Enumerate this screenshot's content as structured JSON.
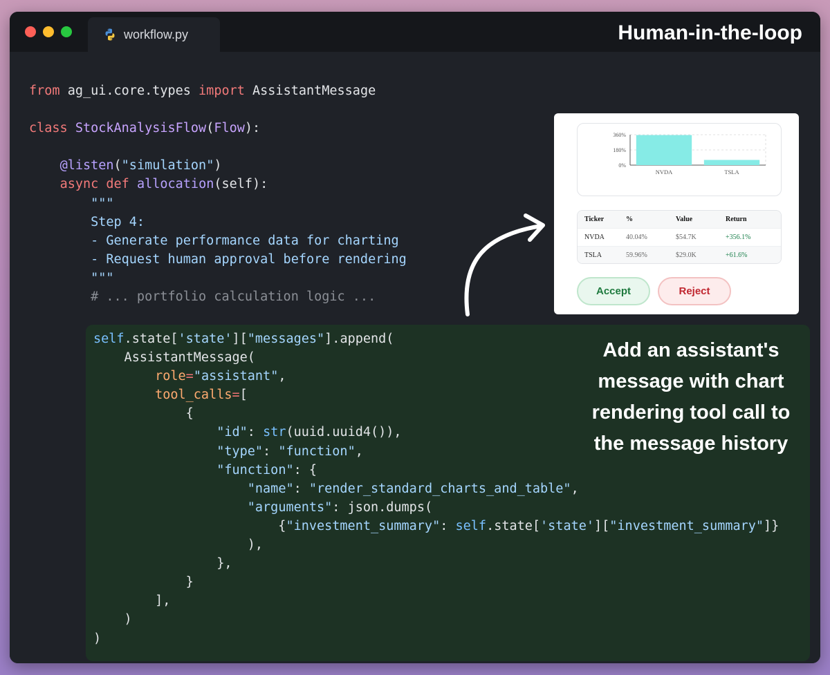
{
  "window": {
    "tab_label": "workflow.py",
    "heading": "Human-in-the-loop"
  },
  "code_top": [
    [
      [
        "kw",
        "from"
      ],
      [
        "p",
        " ag_ui.core.types "
      ],
      [
        "kw",
        "import"
      ],
      [
        "p",
        " AssistantMessage"
      ]
    ],
    [],
    [
      [
        "kw",
        "class"
      ],
      [
        "p",
        " "
      ],
      [
        "cls",
        "StockAnalysisFlow"
      ],
      [
        "p",
        "("
      ],
      [
        "cls",
        "Flow"
      ],
      [
        "p",
        "):"
      ]
    ],
    [],
    [
      [
        "p",
        "    "
      ],
      [
        "fn",
        "@listen"
      ],
      [
        "p",
        "("
      ],
      [
        "str",
        "\"simulation\""
      ],
      [
        "p",
        ")"
      ]
    ],
    [
      [
        "p",
        "    "
      ],
      [
        "kw",
        "async"
      ],
      [
        "p",
        " "
      ],
      [
        "kw",
        "def"
      ],
      [
        "p",
        " "
      ],
      [
        "fn",
        "allocation"
      ],
      [
        "p",
        "(self):"
      ]
    ],
    [
      [
        "p",
        "        "
      ],
      [
        "doc",
        "\"\"\""
      ]
    ],
    [
      [
        "p",
        "        "
      ],
      [
        "doc",
        "Step 4:"
      ]
    ],
    [
      [
        "p",
        "        "
      ],
      [
        "doc",
        "- Generate performance data for charting"
      ]
    ],
    [
      [
        "p",
        "        "
      ],
      [
        "doc",
        "- Request human approval before rendering"
      ]
    ],
    [
      [
        "p",
        "        "
      ],
      [
        "doc",
        "\"\"\""
      ]
    ],
    [
      [
        "p",
        "        "
      ],
      [
        "cm",
        "# ... portfolio calculation logic ..."
      ]
    ]
  ],
  "code_block": [
    [
      [
        "bi",
        "self"
      ],
      [
        "p",
        ".state["
      ],
      [
        "str",
        "'state'"
      ],
      [
        "p",
        "]["
      ],
      [
        "str",
        "\"messages\""
      ],
      [
        "p",
        "].append("
      ]
    ],
    [
      [
        "p",
        "    AssistantMessage("
      ]
    ],
    [
      [
        "p",
        "        "
      ],
      [
        "prop",
        "role"
      ],
      [
        "kw2",
        "="
      ],
      [
        "str",
        "\"assistant\""
      ],
      [
        "p",
        ","
      ]
    ],
    [
      [
        "p",
        "        "
      ],
      [
        "prop",
        "tool_calls"
      ],
      [
        "kw2",
        "="
      ],
      [
        "p",
        "["
      ]
    ],
    [
      [
        "p",
        "            {"
      ]
    ],
    [
      [
        "p",
        "                "
      ],
      [
        "str",
        "\"id\""
      ],
      [
        "p",
        ": "
      ],
      [
        "bi",
        "str"
      ],
      [
        "p",
        "(uuid.uuid4()),"
      ]
    ],
    [
      [
        "p",
        "                "
      ],
      [
        "str",
        "\"type\""
      ],
      [
        "p",
        ": "
      ],
      [
        "str",
        "\"function\""
      ],
      [
        "p",
        ","
      ]
    ],
    [
      [
        "p",
        "                "
      ],
      [
        "str",
        "\"function\""
      ],
      [
        "p",
        ": {"
      ]
    ],
    [
      [
        "p",
        "                    "
      ],
      [
        "str",
        "\"name\""
      ],
      [
        "p",
        ": "
      ],
      [
        "str",
        "\"render_standard_charts_and_table\""
      ],
      [
        "p",
        ","
      ]
    ],
    [
      [
        "p",
        "                    "
      ],
      [
        "str",
        "\"arguments\""
      ],
      [
        "p",
        ": json.dumps("
      ]
    ],
    [
      [
        "p",
        "                        {"
      ],
      [
        "str",
        "\"investment_summary\""
      ],
      [
        "p",
        ": "
      ],
      [
        "bi",
        "self"
      ],
      [
        "p",
        ".state["
      ],
      [
        "str",
        "'state'"
      ],
      [
        "p",
        "]["
      ],
      [
        "str",
        "\"investment_summary\""
      ],
      [
        "p",
        "]}"
      ]
    ],
    [
      [
        "p",
        "                    ),"
      ]
    ],
    [
      [
        "p",
        "                },"
      ]
    ],
    [
      [
        "p",
        "            }"
      ]
    ],
    [
      [
        "p",
        "        ],"
      ]
    ],
    [
      [
        "p",
        "    )"
      ]
    ],
    [
      [
        "p",
        ")"
      ]
    ]
  ],
  "annotation": "Add an assistant's message with chart rendering tool call to the message history",
  "preview": {
    "chart_data": {
      "type": "bar",
      "categories": [
        "NVDA",
        "TSLA"
      ],
      "values": [
        356.1,
        61.6
      ],
      "yticks": [
        "360%",
        "180%",
        "0%"
      ],
      "ylim": [
        0,
        360
      ],
      "color": "#86ebe6"
    },
    "table": {
      "headers": [
        "Ticker",
        "%",
        "Value",
        "Return"
      ],
      "rows": [
        [
          "NVDA",
          "40.04%",
          "$54.7K",
          "+356.1%"
        ],
        [
          "TSLA",
          "59.96%",
          "$29.0K",
          "+61.6%"
        ]
      ]
    },
    "accept_label": "Accept",
    "reject_label": "Reject"
  }
}
